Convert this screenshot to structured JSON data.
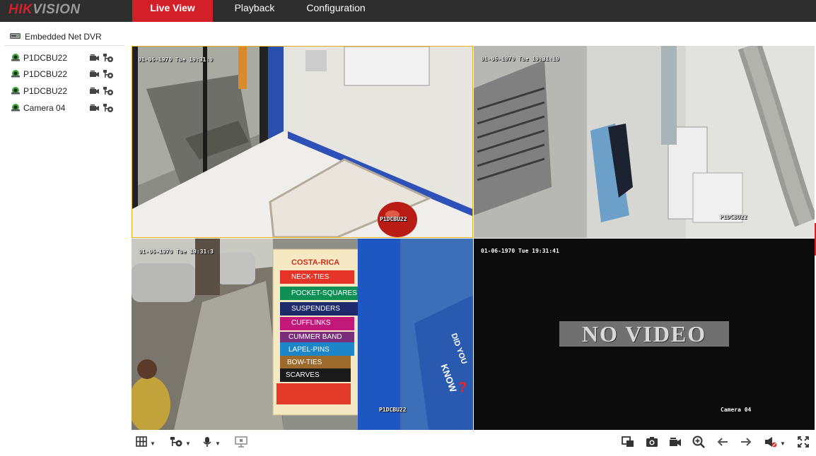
{
  "header": {
    "logo_part1": "HIK",
    "logo_part2": "VISION",
    "tabs": [
      {
        "label": "Live View",
        "active": true
      },
      {
        "label": "Playback",
        "active": false
      },
      {
        "label": "Configuration",
        "active": false
      }
    ]
  },
  "sidebar": {
    "device_name": "Embedded Net DVR",
    "device_icon": "dvr-icon",
    "cameras": [
      {
        "label": "P1DCBU22",
        "icon": "camera-status-icon",
        "actions": [
          "record-icon",
          "ptz-icon"
        ]
      },
      {
        "label": "P1DCBU22",
        "icon": "camera-status-icon",
        "actions": [
          "record-icon",
          "ptz-icon"
        ]
      },
      {
        "label": "P1DCBU22",
        "icon": "camera-status-icon",
        "actions": [
          "record-icon",
          "ptz-icon"
        ]
      },
      {
        "label": "Camera 04",
        "icon": "camera-status-icon",
        "actions": [
          "record-icon",
          "ptz-icon"
        ]
      }
    ]
  },
  "live_view": {
    "tiles": [
      {
        "timestamp": "01-06-1970 Tue 19:31:0",
        "camera_label": "P1DCBU22",
        "selected": true
      },
      {
        "timestamp": "01-06-1970 Tue 19:31:19",
        "camera_label": "P1DCBU22",
        "selected": false
      },
      {
        "timestamp": "01-06-1970 Tue 19:31:3",
        "camera_label": "P1DCBU22",
        "selected": false
      },
      {
        "timestamp": "01-06-1970 Tue 19:31:41",
        "camera_label": "Camera 04",
        "selected": false,
        "no_video_text": "NO VIDEO"
      }
    ],
    "signage": {
      "shop_name": "COSTA-RICA",
      "items": [
        "NECK-TIES",
        "POCKET-SQUARES",
        "SUSPENDERS",
        "CUFFLINKS",
        "CUMMER BAND",
        "LAPEL-PINS",
        "BOW-TIES",
        "SCARVES"
      ],
      "poster_text_1": "DID YOU",
      "poster_text_2": "KNOW",
      "poster_text_3": "?"
    }
  },
  "toolbar": {
    "left": [
      "window-layout-icon",
      "ptz-control-icon",
      "microphone-icon",
      "digital-zoom-icon"
    ],
    "right": [
      "capture-window-icon",
      "snapshot-icon",
      "record-icon",
      "zoom-in-icon",
      "previous-page-icon",
      "next-page-icon",
      "volume-mute-icon",
      "fullscreen-icon"
    ]
  },
  "colors": {
    "accent": "#d32028",
    "topbar": "#2e2e2e",
    "selected_border": "#e8b21a"
  }
}
